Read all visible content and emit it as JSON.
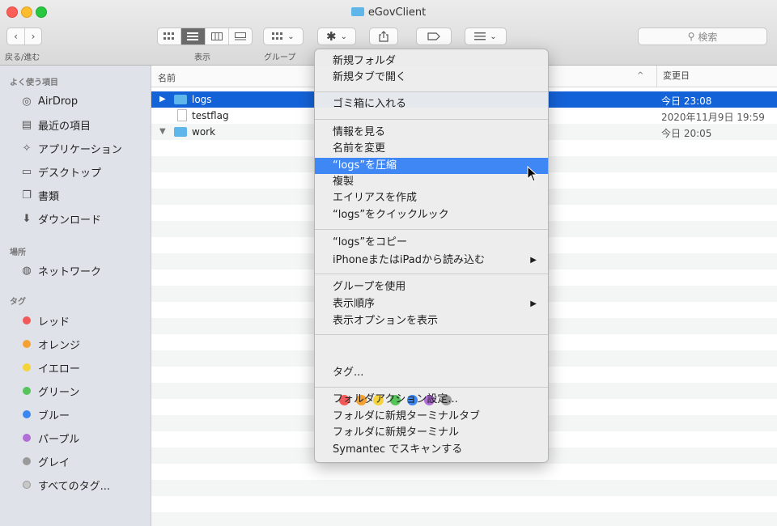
{
  "window": {
    "title": "eGovClient"
  },
  "toolbar": {
    "back_forward_label": "戻る/進む",
    "view_label": "表示",
    "group_label": "グループ",
    "search_placeholder": "検索"
  },
  "sidebar": {
    "favorites_header": "よく使う項目",
    "favorites": [
      {
        "label": "AirDrop",
        "icon": "airdrop-icon"
      },
      {
        "label": "最近の項目",
        "icon": "recents-icon"
      },
      {
        "label": "アプリケーション",
        "icon": "applications-icon"
      },
      {
        "label": "デスクトップ",
        "icon": "desktop-icon"
      },
      {
        "label": "書類",
        "icon": "documents-icon"
      },
      {
        "label": "ダウンロード",
        "icon": "downloads-icon"
      }
    ],
    "locations_header": "場所",
    "locations": [
      {
        "label": "ネットワーク",
        "icon": "network-icon"
      }
    ],
    "tags_header": "タグ",
    "tags": [
      {
        "label": "レッド",
        "color": "#f05a5a"
      },
      {
        "label": "オレンジ",
        "color": "#f5a033"
      },
      {
        "label": "イエロー",
        "color": "#f5d33a"
      },
      {
        "label": "グリーン",
        "color": "#56c45b"
      },
      {
        "label": "ブルー",
        "color": "#3b86f1"
      },
      {
        "label": "パープル",
        "color": "#b06ed6"
      },
      {
        "label": "グレイ",
        "color": "#9a9a9a"
      },
      {
        "label": "すべてのタグ...",
        "color": "#c8c8c8"
      }
    ]
  },
  "filelist": {
    "col_name": "名前",
    "col_modified": "変更日",
    "rows": [
      {
        "name": "logs",
        "date": "今日 23:08",
        "kind": "folder",
        "disclosure": "▶",
        "selected": true
      },
      {
        "name": "testflag",
        "date": "2020年11月9日 19:59",
        "kind": "file",
        "disclosure": "",
        "selected": false
      },
      {
        "name": "work",
        "date": "今日 20:05",
        "kind": "folder",
        "disclosure": "▼",
        "selected": false
      }
    ]
  },
  "context_menu": {
    "items": [
      {
        "label": "新規フォルダ"
      },
      {
        "label": "新規タブで開く"
      },
      {
        "label": "ゴミ箱に入れる"
      },
      {
        "label": "情報を見る"
      },
      {
        "label": "名前を変更"
      },
      {
        "label": "“logs”を圧縮",
        "highlighted": true
      },
      {
        "label": "複製"
      },
      {
        "label": "エイリアスを作成"
      },
      {
        "label": "“logs”をクイックルック"
      },
      {
        "label": "“logs”をコピー"
      },
      {
        "label": "iPhoneまたはiPadから読み込む",
        "submenu": true
      },
      {
        "label": "グループを使用"
      },
      {
        "label": "表示順序",
        "submenu": true
      },
      {
        "label": "表示オプションを表示"
      },
      {
        "label": "タグ..."
      },
      {
        "label": "フォルダアクション設定..."
      },
      {
        "label": "フォルダに新規ターミナルタブ"
      },
      {
        "label": "フォルダに新規ターミナル"
      },
      {
        "label": "Symantec でスキャンする"
      }
    ],
    "tag_colors": [
      "#f05a5a",
      "#f5a033",
      "#f5d33a",
      "#56c45b",
      "#3b86f1",
      "#b06ed6",
      "#9a9a9a"
    ]
  }
}
